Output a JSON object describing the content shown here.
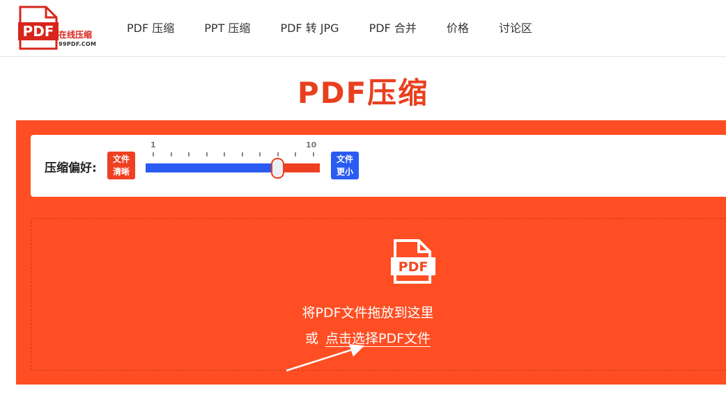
{
  "header": {
    "logo": {
      "mark_text": "PDF",
      "name": "在线压缩",
      "domain": "99PDF.COM"
    },
    "nav": [
      {
        "label": "PDF 压缩"
      },
      {
        "label": "PPT 压缩"
      },
      {
        "label": "PDF 转 JPG"
      },
      {
        "label": "PDF 合并"
      },
      {
        "label": "价格"
      },
      {
        "label": "讨论区"
      }
    ]
  },
  "main": {
    "title": "PDF压缩",
    "preference": {
      "label": "压缩偏好:",
      "left_tag": "文件\n清晰",
      "left_tag_line1": "文件",
      "left_tag_line2": "清晰",
      "right_tag_line1": "文件",
      "right_tag_line2": "更小",
      "slider": {
        "min_label": "1",
        "max_label": "10",
        "min": 1,
        "max": 10,
        "value": 8
      }
    },
    "dropzone": {
      "icon_text": "PDF",
      "drop_text": "将PDF文件拖放到这里",
      "or_text": "或",
      "choose_link": "点击选择PDF文件"
    }
  },
  "colors": {
    "brand_red": "#d8251c",
    "panel_orange": "#ff4e23",
    "title_orange": "#e8401f",
    "blue": "#2a5cf2"
  },
  "icons": {
    "logo": "pdf-file-icon",
    "dropzone": "pdf-document-icon",
    "annotation": "arrow-pointer-icon"
  }
}
